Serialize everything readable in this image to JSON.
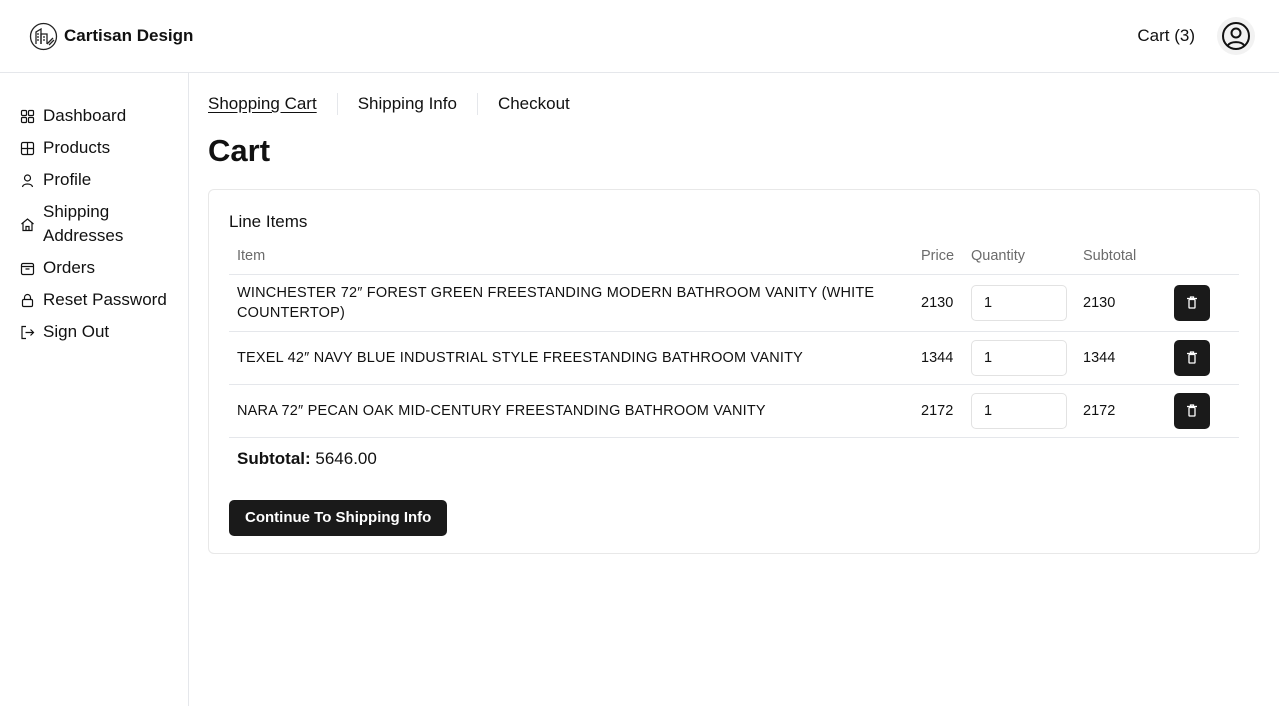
{
  "header": {
    "brand_name": "Cartisan Design",
    "cart_label": "Cart (3)"
  },
  "sidebar": {
    "items": [
      {
        "label": "Dashboard",
        "icon": "grid-icon"
      },
      {
        "label": "Products",
        "icon": "table-icon"
      },
      {
        "label": "Profile",
        "icon": "user-icon"
      },
      {
        "label": "Shipping Addresses",
        "icon": "home-icon"
      },
      {
        "label": "Orders",
        "icon": "package-icon"
      },
      {
        "label": "Reset Password",
        "icon": "lock-icon"
      },
      {
        "label": "Sign Out",
        "icon": "sign-out-icon"
      }
    ]
  },
  "steps": [
    {
      "label": "Shopping Cart",
      "active": true
    },
    {
      "label": "Shipping Info",
      "active": false
    },
    {
      "label": "Checkout",
      "active": false
    }
  ],
  "page_title": "Cart",
  "card": {
    "title": "Line Items",
    "columns": {
      "item": "Item",
      "price": "Price",
      "quantity": "Quantity",
      "subtotal": "Subtotal"
    },
    "rows": [
      {
        "item": "WINCHESTER 72″ FOREST GREEN FREESTANDING MODERN BATHROOM VANITY (WHITE COUNTERTOP)",
        "price": "2130",
        "quantity": "1",
        "subtotal": "2130"
      },
      {
        "item": "TEXEL 42″ NAVY BLUE INDUSTRIAL STYLE FREESTANDING BATHROOM VANITY",
        "price": "1344",
        "quantity": "1",
        "subtotal": "1344"
      },
      {
        "item": "NARA 72″ PECAN OAK MID-CENTURY FREESTANDING BATHROOM VANITY",
        "price": "2172",
        "quantity": "1",
        "subtotal": "2172"
      }
    ],
    "subtotal_label": "Subtotal:",
    "subtotal_value": "5646.00",
    "continue_label": "Continue To Shipping Info"
  },
  "colors": {
    "primary_button": "#1a1a1a",
    "border": "#e5e7eb",
    "muted_text": "#6b6b6b"
  }
}
